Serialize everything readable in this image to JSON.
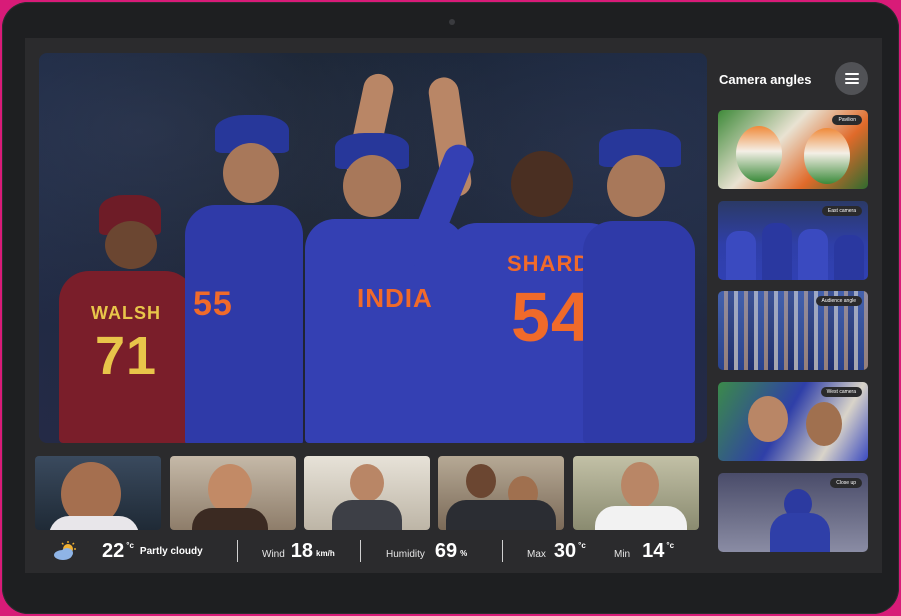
{
  "sidebar": {
    "title": "Camera angles",
    "menu_icon": "hamburger-menu-icon",
    "cameras": [
      {
        "label": "Pavilion"
      },
      {
        "label": "East camera"
      },
      {
        "label": "Audience angle"
      },
      {
        "label": "West camera"
      },
      {
        "label": "Close up"
      }
    ]
  },
  "main_video": {
    "jersey_left_number": "71",
    "jersey_left_name": "WALSH",
    "jersey_right_name": "SHARDUL",
    "jersey_right_number": "54",
    "jersey_chest": "INDIA"
  },
  "participants": [
    {
      "name": "participant-1"
    },
    {
      "name": "participant-2"
    },
    {
      "name": "participant-3"
    },
    {
      "name": "participant-4"
    },
    {
      "name": "participant-5"
    }
  ],
  "weather": {
    "icon": "partly-cloudy-icon",
    "temp": "22",
    "temp_unit": "°c",
    "condition": "Partly cloudy",
    "wind_label": "Wind",
    "wind_value": "18",
    "wind_unit": "km/h",
    "humidity_label": "Humidity",
    "humidity_value": "69",
    "humidity_unit": "%",
    "max_label": "Max",
    "max_value": "30",
    "max_unit": "°c",
    "min_label": "Min",
    "min_value": "14",
    "min_unit": "°c"
  },
  "colors": {
    "frame": "#d81b78",
    "device": "#1e1f21",
    "screen": "#2b2b2d",
    "india_blue": "#2f3aa8",
    "india_orange": "#f06a2a",
    "wi_maroon": "#7a1e2a"
  }
}
